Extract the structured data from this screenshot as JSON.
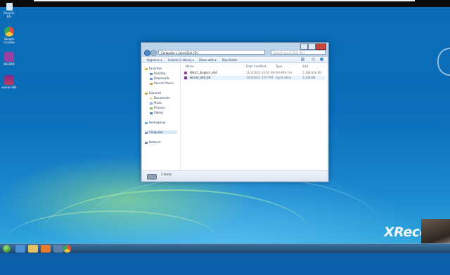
{
  "desktop": {
    "icons": [
      {
        "label": "Recycle Bin",
        "icon": "recycle-bin-icon",
        "color": "#d8e4ee"
      },
      {
        "label": "Google Chrome",
        "icon": "chrome-icon",
        "color": "#e04a3a"
      },
      {
        "label": "WinRAR",
        "icon": "winrar-icon",
        "color": "#9b3fa1"
      },
      {
        "label": "winrar-x64",
        "icon": "installer-icon",
        "color": "#7a2a90"
      }
    ]
  },
  "window": {
    "address": "Computer ▸ Local Disk (D:)",
    "search_placeholder": "Search Local Disk (D:)",
    "toolbar": {
      "organize": "Organize ▾",
      "include": "Include in library ▾",
      "share": "Share with ▾",
      "new_folder": "New folder"
    },
    "nav": {
      "favorites": "Favorites",
      "desktop": "Desktop",
      "downloads": "Downloads",
      "recent": "Recent Places",
      "libraries": "Libraries",
      "documents": "Documents",
      "music": "Music",
      "pictures": "Pictures",
      "videos": "Videos",
      "homegroup": "Homegroup",
      "computer": "Computer",
      "network": "Network"
    },
    "columns": {
      "name": "Name",
      "date": "Date modified",
      "type": "Type",
      "size": "Size"
    },
    "files": [
      {
        "name": "Win11_English_x64",
        "date": "11/2/2021 10:05 AM",
        "type": "WinRAR File",
        "size": "5,388,648 KB",
        "icon": "rar-file-icon"
      },
      {
        "name": "winrar_x64_bit",
        "date": "10/9/2021 3:57 PM",
        "type": "Application",
        "size": "3,338 KB",
        "icon": "application-icon"
      }
    ],
    "status": "2 items"
  },
  "overlay": {
    "watermark": "XReco"
  },
  "colors": {
    "desktop_blue": "#0c6bb6",
    "taskbar": "#1f4770",
    "window_frame": "#bcd3ea"
  }
}
